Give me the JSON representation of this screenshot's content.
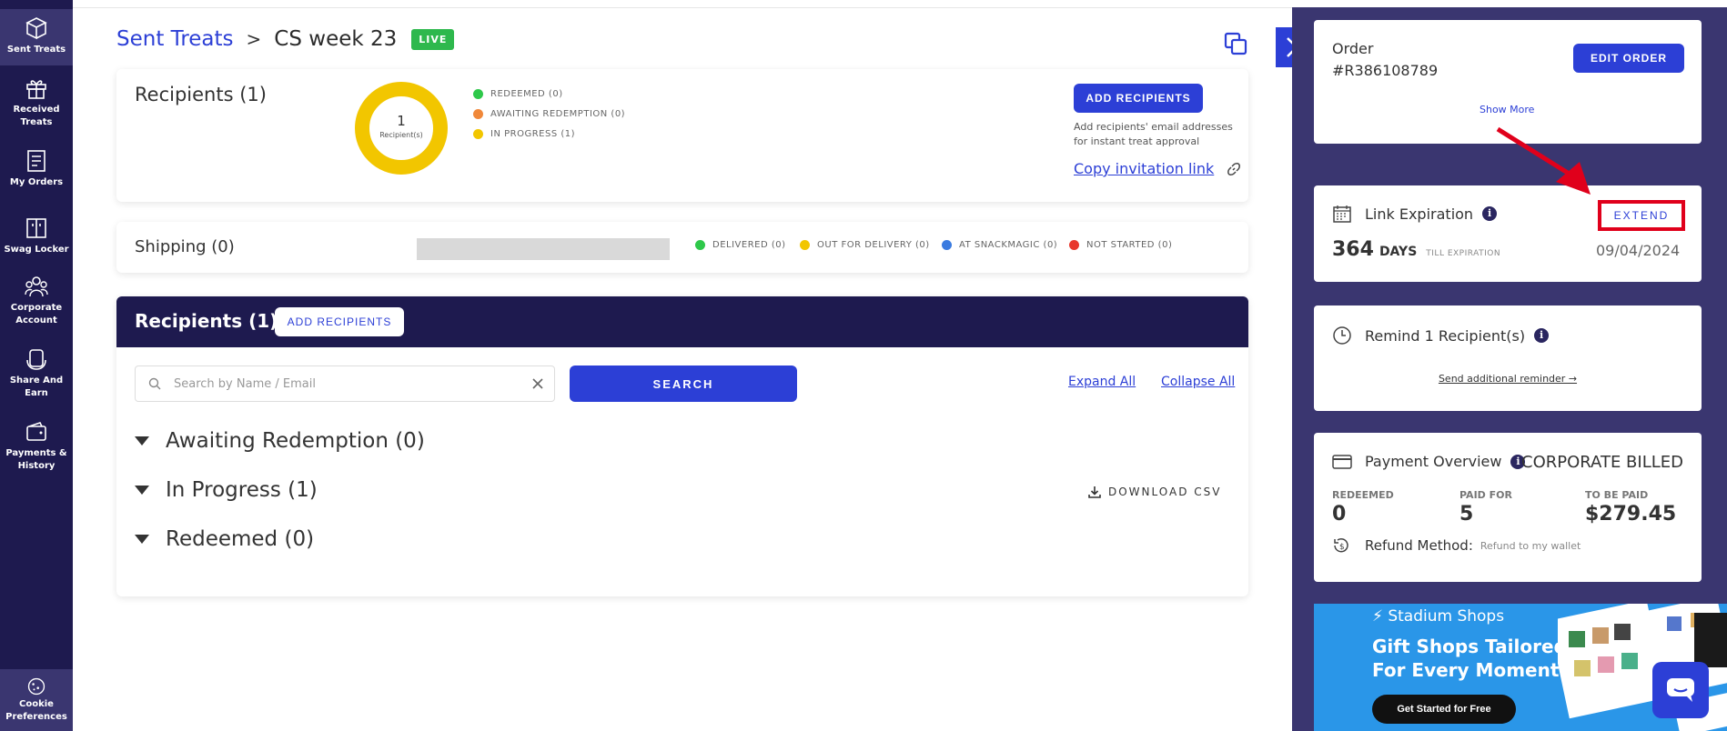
{
  "nav": {
    "items": [
      {
        "label": "Sent Treats",
        "icon": "box-icon"
      },
      {
        "label": "Received Treats",
        "icon": "gift-icon"
      },
      {
        "label": "My Orders",
        "icon": "receipt-icon"
      },
      {
        "label": "Swag Locker",
        "icon": "locker-icon"
      },
      {
        "label": "Corporate Account",
        "icon": "people-icon"
      },
      {
        "label": "Share And Earn",
        "icon": "share-icon"
      },
      {
        "label": "Payments & History",
        "icon": "wallet-icon"
      }
    ],
    "cookie_label": "Cookie Preferences"
  },
  "breadcrumb": {
    "root": "Sent Treats",
    "separator": ">",
    "current": "CS week 23",
    "badge": "LIVE"
  },
  "recipients_summary": {
    "title": "Recipients (1)",
    "donut_count": "1",
    "donut_label": "Recipient(s)",
    "legend": [
      {
        "label": "REDEEMED (0)",
        "color": "#2ec84a"
      },
      {
        "label": "AWAITING REDEMPTION (0)",
        "color": "#f0883a"
      },
      {
        "label": "IN PROGRESS (1)",
        "color": "#f2c600"
      }
    ],
    "add_button": "ADD RECIPIENTS",
    "add_help": "Add recipients' email addresses for instant treat approval",
    "invite_link": "Copy invitation link"
  },
  "shipping": {
    "title": "Shipping (0)",
    "legend": [
      {
        "label": "DELIVERED (0)",
        "color": "#2ec84a"
      },
      {
        "label": "OUT FOR DELIVERY (0)",
        "color": "#f2c600"
      },
      {
        "label": "AT SNACKMAGIC (0)",
        "color": "#3a7be0"
      },
      {
        "label": "NOT STARTED (0)",
        "color": "#e8372c"
      }
    ]
  },
  "recipient_list": {
    "title": "Recipients (1)",
    "add_button": "ADD RECIPIENTS",
    "search_placeholder": "Search by Name / Email",
    "search_button": "SEARCH",
    "expand_all": "Expand All",
    "collapse_all": "Collapse All",
    "groups": [
      "Awaiting Redemption (0)",
      "In Progress (1)",
      "Redeemed (0)"
    ],
    "download_csv": "DOWNLOAD CSV"
  },
  "order": {
    "label": "Order",
    "number": "#R386108789",
    "edit_button": "EDIT ORDER",
    "show_more": "Show More"
  },
  "link_expiration": {
    "title": "Link Expiration",
    "extend_button": "EXTEND",
    "days_value": "364",
    "days_unit": "DAYS",
    "days_suffix": "TILL EXPIRATION",
    "date": "09/04/2024"
  },
  "reminder": {
    "title": "Remind 1 Recipient(s)",
    "link": "Send additional reminder →"
  },
  "payment": {
    "title": "Payment Overview",
    "billing": "CORPORATE BILLED",
    "stats": [
      {
        "label": "REDEEMED",
        "value": "0"
      },
      {
        "label": "PAID FOR",
        "value": "5"
      },
      {
        "label": "TO BE PAID",
        "value": "$279.45"
      }
    ],
    "refund_label": "Refund Method:",
    "refund_value": "Refund to my wallet"
  },
  "ad": {
    "brand": "Stadium Shops",
    "headline_1": "Gift Shops Tailored",
    "headline_2": "For Every Moment",
    "button": "Get Started for Free"
  },
  "colors": {
    "navy": "#1e1a4f",
    "panel": "#3a3670",
    "accent": "#2c3fd6",
    "live": "#2eb84d",
    "highlight": "#e0001b"
  }
}
